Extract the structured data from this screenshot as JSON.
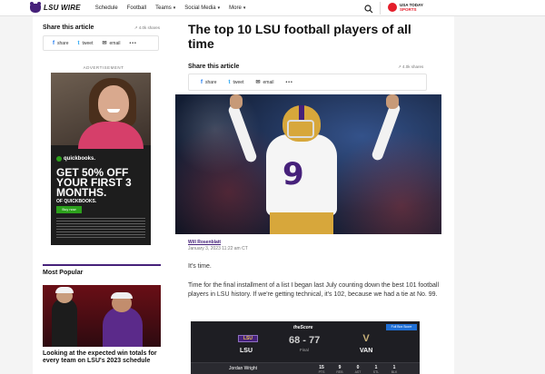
{
  "nav": {
    "logo_text": "LSU WIRE",
    "items": [
      {
        "label": "Schedule",
        "dropdown": false
      },
      {
        "label": "Football",
        "dropdown": false
      },
      {
        "label": "Teams",
        "dropdown": true
      },
      {
        "label": "Social Media",
        "dropdown": true
      },
      {
        "label": "More",
        "dropdown": true
      }
    ],
    "chevron": "▾",
    "search_icon": "search-icon",
    "partner": {
      "line1": "USA TODAY",
      "line2": "SPORTS"
    }
  },
  "share_small": {
    "title": "Share this article",
    "count": "↗ 4.0k shares",
    "buttons": [
      {
        "icon": "f",
        "label": "share"
      },
      {
        "icon": "t",
        "label": "tweet"
      },
      {
        "icon": "✉",
        "label": "email"
      }
    ],
    "more": "•••"
  },
  "ad": {
    "label": "ADVERTISEMENT",
    "brand": "quickbooks.",
    "headline": "GET 50% OFF YOUR FIRST 3 MONTHS.",
    "sub": "OF QUICKBOOKS.",
    "cta": "Buy now"
  },
  "most_popular": {
    "title": "Most Popular",
    "headline": "Looking at the expected win totals for every team on LSU's 2023 schedule"
  },
  "article": {
    "headline": "The top 10 LSU football players of all time",
    "share_title": "Share this article",
    "share_count": "↗ 4.0k shares",
    "share_buttons": [
      {
        "icon": "f",
        "label": "share"
      },
      {
        "icon": "t",
        "label": "tweet"
      },
      {
        "icon": "✉",
        "label": "email"
      }
    ],
    "share_more": "•••",
    "jersey_number": "9",
    "author": "Will Rosenblatt",
    "date": "January 3, 2023 11:22 am CT",
    "p1": "It's time.",
    "p2": "Time for the final installment of a list I began last July counting down the best 101 football players in LSU history. If we're getting technical, it's 102, because we had a tie at No. 99."
  },
  "scorebox": {
    "brand": "theScore",
    "badge": "Full Box Score",
    "home": "LSU",
    "away": "VAN",
    "home_logo": "LSU",
    "away_logo": "V",
    "score": "68 - 77",
    "status": "Final",
    "player": "Jordan Wright",
    "stats": [
      {
        "value": "15",
        "label": "PTS"
      },
      {
        "value": "9",
        "label": "REB"
      },
      {
        "value": "0",
        "label": "AST"
      },
      {
        "value": "1",
        "label": "STL"
      },
      {
        "value": "1",
        "label": "BLK"
      }
    ]
  },
  "colors": {
    "lsu_purple": "#46217a",
    "lsu_gold": "#d7a73b",
    "usat_red": "#e41e2b"
  }
}
